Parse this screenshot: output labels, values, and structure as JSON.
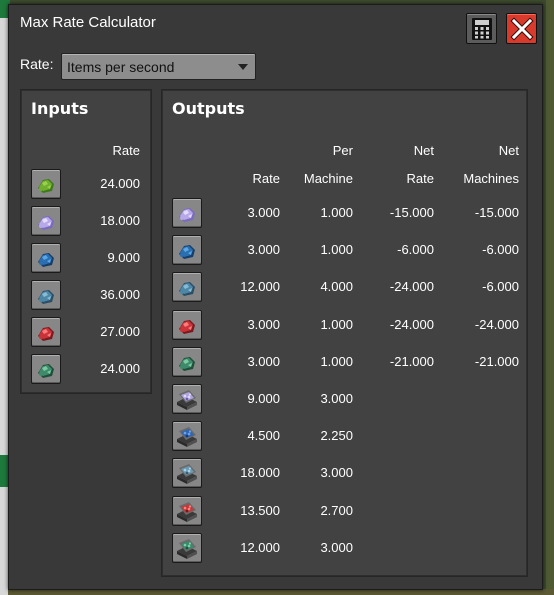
{
  "window": {
    "title": "Max Rate Calculator"
  },
  "rate": {
    "label": "Rate:",
    "selected": "Items per second"
  },
  "inputs": {
    "title": "Inputs",
    "header_rate": "Rate",
    "rows": [
      {
        "icon": "green-ore-icon",
        "rate": "24.000"
      },
      {
        "icon": "purple-crystal-icon",
        "rate": "18.000"
      },
      {
        "icon": "blue-ore-icon",
        "rate": "9.000"
      },
      {
        "icon": "cyan-ore-icon",
        "rate": "36.000"
      },
      {
        "icon": "red-crystal-icon",
        "rate": "27.000"
      },
      {
        "icon": "teal-ore-icon",
        "rate": "24.000"
      }
    ]
  },
  "outputs": {
    "title": "Outputs",
    "headers": {
      "rate": "Rate",
      "per_top": "Per",
      "per_bottom": "Machine",
      "netrate_top": "Net",
      "netrate_bottom": "Rate",
      "netmach_top": "Net",
      "netmach_bottom": "Machines"
    },
    "rows": [
      {
        "icon": "purple-crystal-icon",
        "rate": "3.000",
        "per_machine": "1.000",
        "net_rate": "-15.000",
        "net_machines": "-15.000"
      },
      {
        "icon": "blue-ore-icon",
        "rate": "3.000",
        "per_machine": "1.000",
        "net_rate": "-6.000",
        "net_machines": "-6.000"
      },
      {
        "icon": "cyan-ore-icon",
        "rate": "12.000",
        "per_machine": "4.000",
        "net_rate": "-24.000",
        "net_machines": "-6.000"
      },
      {
        "icon": "red-crystal-icon",
        "rate": "3.000",
        "per_machine": "1.000",
        "net_rate": "-24.000",
        "net_machines": "-24.000"
      },
      {
        "icon": "teal-ore-icon",
        "rate": "3.000",
        "per_machine": "1.000",
        "net_rate": "-21.000",
        "net_machines": "-21.000"
      },
      {
        "icon": "purple-crate-icon",
        "rate": "9.000",
        "per_machine": "3.000",
        "net_rate": "",
        "net_machines": ""
      },
      {
        "icon": "blue-crate-icon",
        "rate": "4.500",
        "per_machine": "2.250",
        "net_rate": "",
        "net_machines": ""
      },
      {
        "icon": "cyan-crate-icon",
        "rate": "18.000",
        "per_machine": "3.000",
        "net_rate": "",
        "net_machines": ""
      },
      {
        "icon": "red-crate-icon",
        "rate": "13.500",
        "per_machine": "2.700",
        "net_rate": "",
        "net_machines": ""
      },
      {
        "icon": "teal-crate-icon",
        "rate": "12.000",
        "per_machine": "3.000",
        "net_rate": "",
        "net_machines": ""
      }
    ]
  }
}
